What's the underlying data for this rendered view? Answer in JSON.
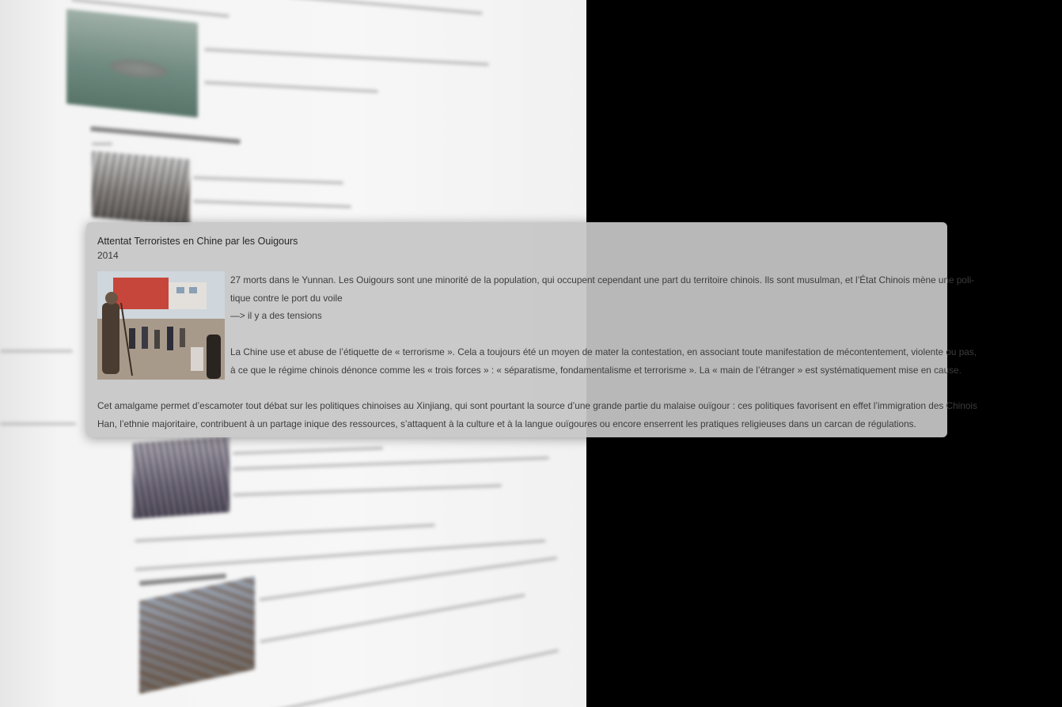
{
  "article": {
    "title": "Attentat Terroristes en Chine par les Ouigours",
    "year": "2014",
    "paragraph1_lines": [
      "27 morts dans le Yunnan. Les Ouigours sont une minorité de la population, qui occupent cependant une part du territoire chinois. Ils sont musulman, et l’État Chinois mène une poli-",
      "tique contre le port du voile",
      " —> il y a des tensions"
    ],
    "paragraph2_lines": [
      "La Chine use et abuse de l’étiquette de « terrorisme ». Cela a toujours été un moyen de mater la contestation, en associant toute manifestation de mécontentement, violente ou pas,",
      "à ce que le régime chinois dénonce comme les « trois forces » : « séparatisme, fondamentalisme et terrorisme ». La « main de l’étranger » est systématiquement mise en cause."
    ],
    "paragraph3_lines": [
      "Cet amalgame permet d’escamoter tout débat sur les politiques chinoises au Xinjiang, qui sont pourtant la source d’une grande partie du malaise ouïgour : ces politiques favorisent en effet l’immigration des Chinois",
      "Han, l’ethnie majoritaire, contribuent à un partage inique des ressources, s’attaquent à la culture et à la langue ouïgoures ou encore enserrent les pratiques religieuses dans un carcan de régulations."
    ]
  },
  "colors": {
    "background": "#000000",
    "card": "#c6c6c6",
    "text": "#3c3c3c",
    "page": "#f4f4f4"
  }
}
